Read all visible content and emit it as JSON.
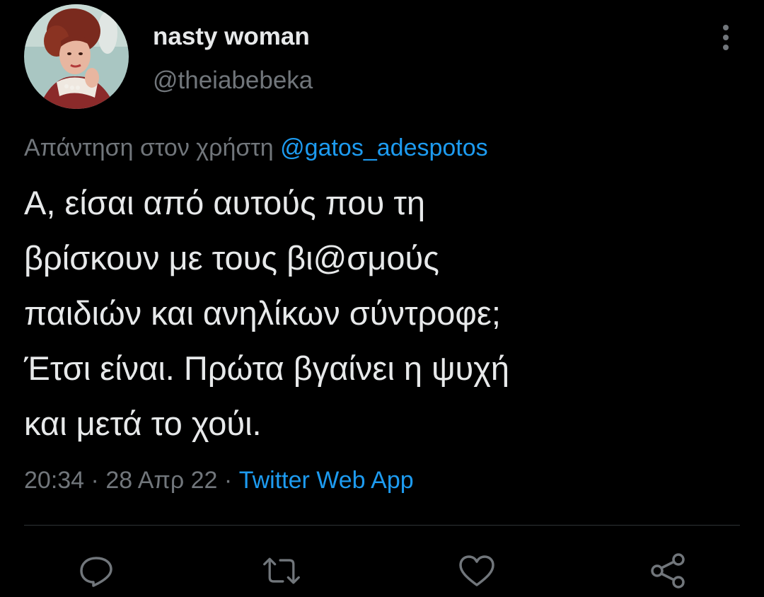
{
  "author": {
    "display_name": "nasty woman",
    "handle": "@theiabebeka"
  },
  "reply": {
    "prefix": "Απάντηση στον χρήστη",
    "mention": "@gatos_adespotos"
  },
  "tweet": {
    "lines": [
      "Α, είσαι από αυτούς που τη",
      "βρίσκουν με τους βι@σμούς",
      "παιδιών και ανηλίκων σύντροφε;",
      "Έτσι είναι. Πρώτα βγαίνει η ψυχή",
      "και μετά το χούι."
    ]
  },
  "meta": {
    "time": "20:34",
    "separator": "·",
    "date": "28 Απρ 22",
    "source": "Twitter Web App"
  },
  "icons": {
    "more": "more-vertical-icon",
    "reply": "reply-icon",
    "retweet": "retweet-icon",
    "like": "heart-icon",
    "share": "share-icon"
  },
  "colors": {
    "background": "#000000",
    "text": "#e7e9ea",
    "secondary": "#71767b",
    "accent": "#1d9bf0",
    "divider": "#2f3336"
  }
}
